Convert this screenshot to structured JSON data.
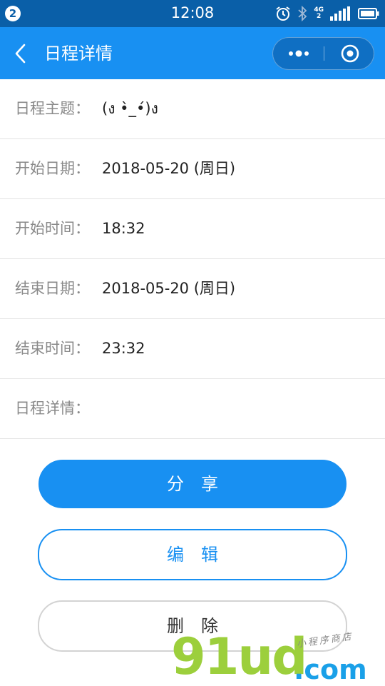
{
  "status_bar": {
    "notification_count": "2",
    "time": "12:08",
    "network_label_top": "4G",
    "network_label_bottom": "2",
    "icons": [
      "alarm-icon",
      "bluetooth-icon",
      "signal-icon",
      "battery-icon"
    ]
  },
  "nav": {
    "back_icon": "chevron-left-icon",
    "title": "日程详情",
    "capsule": {
      "more_icon": "more-dots-icon",
      "close_icon": "target-icon"
    }
  },
  "schedule": {
    "rows": [
      {
        "label": "日程主题：",
        "value": "(ง •̀_•́)ง"
      },
      {
        "label": "开始日期：",
        "value": "2018-05-20 (周日)"
      },
      {
        "label": "开始时间：",
        "value": "18:32"
      },
      {
        "label": "结束日期：",
        "value": "2018-05-20 (周日)"
      },
      {
        "label": "结束时间：",
        "value": "23:32"
      },
      {
        "label": "日程详情：",
        "value": ""
      }
    ]
  },
  "actions": {
    "share_label": "分享",
    "edit_label": "编辑",
    "delete_label": "删除"
  },
  "watermark": {
    "main": "91ud",
    "suffix": ".com",
    "tagline": "小程序商店"
  },
  "colors": {
    "status_bar": "#0a5fa8",
    "nav_bar": "#1890f2",
    "primary": "#1890f2",
    "label_text": "#8a8a8a",
    "value_text": "#222222",
    "divider": "#e3e3e3"
  }
}
